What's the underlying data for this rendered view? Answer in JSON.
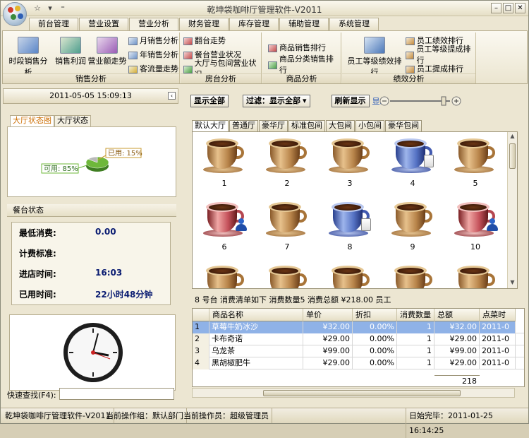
{
  "window": {
    "title": "乾坤袋咖啡厅管理软件-V2011"
  },
  "tabs": [
    "前台管理",
    "营业设置",
    "营业分析",
    "财务管理",
    "库存管理",
    "辅助管理",
    "系统管理"
  ],
  "ribbon": {
    "sales_group": {
      "label": "销售分析",
      "big": [
        "时段销售分析",
        "销售利润",
        "营业额走势"
      ],
      "small": [
        "月销售分析",
        "年销售分析",
        "客流量走势"
      ]
    },
    "room_group": {
      "label": "房台分析",
      "small": [
        "翻台走势",
        "餐台营业状况",
        "大厅与包间营业状况"
      ]
    },
    "goods_group": {
      "label": "商品分析",
      "small": [
        "商品销售排行",
        "商品分类销售排行"
      ]
    },
    "staff_group": {
      "label": "绩效分析",
      "big": [
        "员工等级绩效排行"
      ],
      "small": [
        "员工绩效排行",
        "员工等级提成排行",
        "员工提成排行"
      ]
    }
  },
  "left": {
    "datetime": "2011-05-05 15:09:13",
    "subtabs": [
      "大厅状态图",
      "大厅状态"
    ],
    "chart_data": {
      "type": "pie",
      "categories": [
        "可用",
        "已用"
      ],
      "values": [
        85,
        15
      ],
      "labels": [
        "可用: 85%",
        "已用: 15%"
      ],
      "colors": {
        "available": "#6eb83a",
        "used": "#b9b9b9"
      }
    },
    "table_status_title": "餐台状态",
    "fields": [
      {
        "label": "最低消费:",
        "value": "0.00"
      },
      {
        "label": "计费标准:",
        "value": ""
      },
      {
        "label": "进店时间:",
        "value": "16:03"
      },
      {
        "label": "已用时间:",
        "value": "22小时48分钟"
      }
    ],
    "quick_search_label": "快速查找(F4):",
    "quick_search_value": ""
  },
  "toolbar": {
    "show_all": "显示全部",
    "filter": "过滤：显示全部",
    "refresh": "刷新显示",
    "display_label": "显示"
  },
  "content_tabs": [
    "默认大厅",
    "普通厅",
    "豪华厅",
    "标准包间",
    "大包间",
    "小包间",
    "豪华包间"
  ],
  "tables": [
    {
      "num": "1",
      "state": "free"
    },
    {
      "num": "2",
      "state": "free"
    },
    {
      "num": "3",
      "state": "free"
    },
    {
      "num": "4",
      "state": "billed"
    },
    {
      "num": "5",
      "state": "free"
    },
    {
      "num": "6",
      "state": "occupied"
    },
    {
      "num": "7",
      "state": "free"
    },
    {
      "num": "8",
      "state": "billed"
    },
    {
      "num": "9",
      "state": "free"
    },
    {
      "num": "10",
      "state": "occupied"
    },
    {
      "num": "",
      "state": "free"
    },
    {
      "num": "",
      "state": "free"
    },
    {
      "num": "",
      "state": "free"
    },
    {
      "num": "",
      "state": "free"
    },
    {
      "num": "",
      "state": "free"
    }
  ],
  "consumption": {
    "summary": "8 号台  消费清单如下  消费数量5  消费总额 ¥218.00  员工",
    "columns": [
      "",
      "商品名称",
      "单价",
      "折扣",
      "消费数量",
      "总额",
      "点菜时"
    ],
    "rows": [
      [
        "1",
        "草莓牛奶冰沙",
        "¥32.00",
        "0.00%",
        "1",
        "¥32.00",
        "2011-0"
      ],
      [
        "2",
        "卡布奇诺",
        "¥29.00",
        "0.00%",
        "1",
        "¥29.00",
        "2011-0"
      ],
      [
        "3",
        "乌龙茶",
        "¥99.00",
        "0.00%",
        "1",
        "¥99.00",
        "2011-0"
      ],
      [
        "4",
        "黑胡椒肥牛",
        "¥29.00",
        "0.00%",
        "1",
        "¥29.00",
        "2011-0"
      ]
    ],
    "total": "218"
  },
  "statusbar": {
    "app": "乾坤袋咖啡厅管理软件-V2011",
    "group": "当前操作组：默认部门",
    "user": "当前操作员：超级管理员",
    "close": "日始完毕：2011-01-25 16:14:25"
  }
}
